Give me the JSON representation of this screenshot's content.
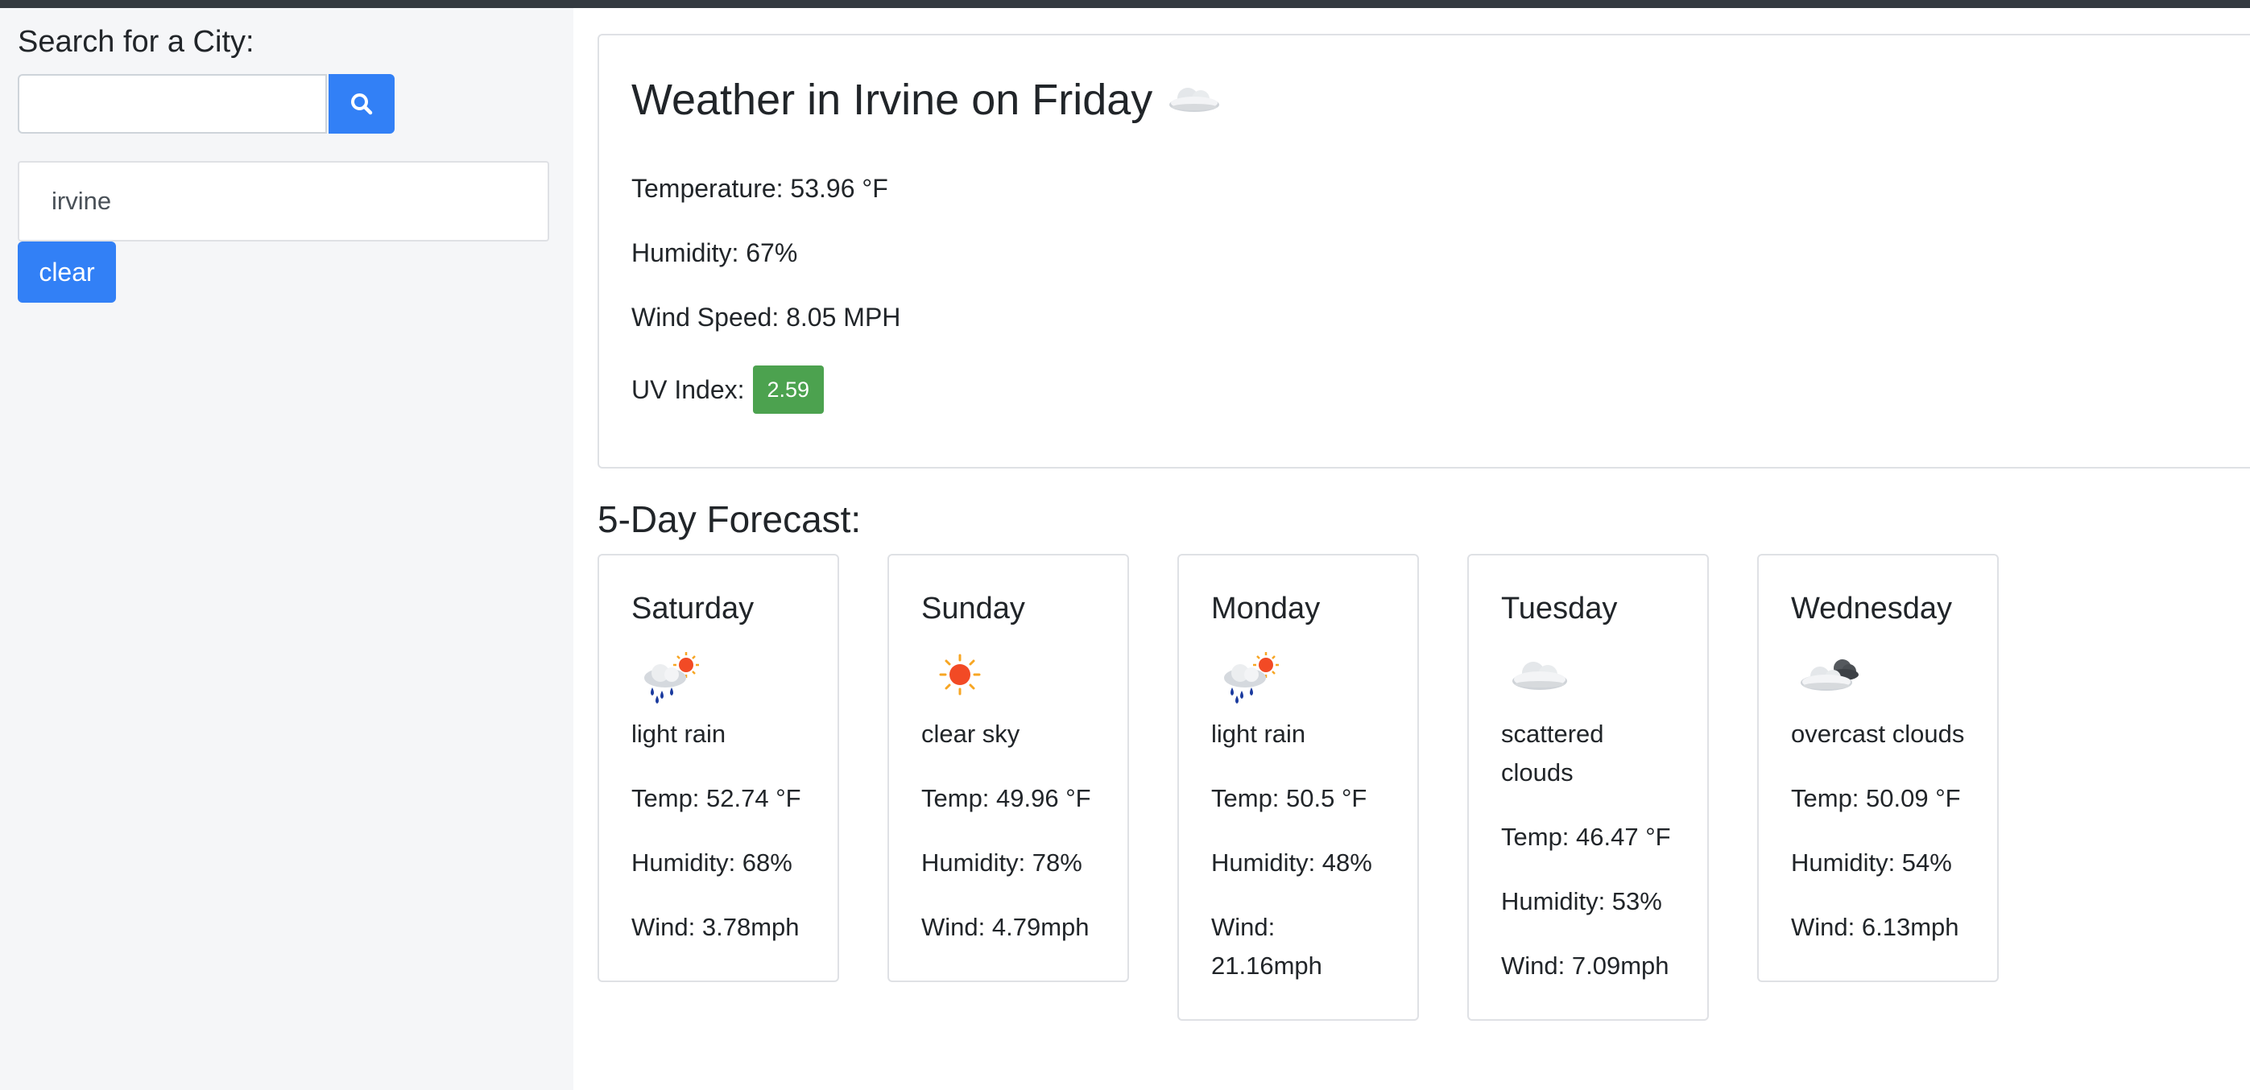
{
  "sidebar": {
    "title": "Search for a City:",
    "search": {
      "value": "",
      "placeholder": ""
    },
    "history": [
      {
        "label": "irvine"
      }
    ],
    "clear_label": "clear"
  },
  "current": {
    "title": "Weather in Irvine on Friday",
    "icon": "scattered-clouds-icon",
    "temperature": "Temperature: 53.96 °F",
    "humidity": "Humidity: 67%",
    "wind": "Wind Speed: 8.05 MPH",
    "uv_label": "UV Index:",
    "uv_value": "2.59",
    "uv_color": "#4ca24f"
  },
  "forecast": {
    "title": "5-Day Forecast:",
    "days": [
      {
        "day": "Saturday",
        "icon": "light-rain-icon",
        "desc": "light rain",
        "temp": "Temp: 52.74 °F",
        "humidity": "Humidity: 68%",
        "wind": "Wind: 3.78mph"
      },
      {
        "day": "Sunday",
        "icon": "clear-sky-icon",
        "desc": "clear sky",
        "temp": "Temp: 49.96 °F",
        "humidity": "Humidity: 78%",
        "wind": "Wind: 4.79mph"
      },
      {
        "day": "Monday",
        "icon": "light-rain-icon",
        "desc": "light rain",
        "temp": "Temp: 50.5 °F",
        "humidity": "Humidity: 48%",
        "wind": "Wind: 21.16mph"
      },
      {
        "day": "Tuesday",
        "icon": "scattered-clouds-icon",
        "desc": "scattered clouds",
        "temp": "Temp: 46.47 °F",
        "humidity": "Humidity: 53%",
        "wind": "Wind: 7.09mph"
      },
      {
        "day": "Wednesday",
        "icon": "overcast-clouds-icon",
        "desc": "overcast clouds",
        "temp": "Temp: 50.09 °F",
        "humidity": "Humidity: 54%",
        "wind": "Wind: 6.13mph"
      }
    ]
  },
  "colors": {
    "accent": "#3280f6",
    "topbar": "#343a40",
    "sidebar_bg": "#f5f6f8",
    "card_border": "#dfe1e5"
  }
}
